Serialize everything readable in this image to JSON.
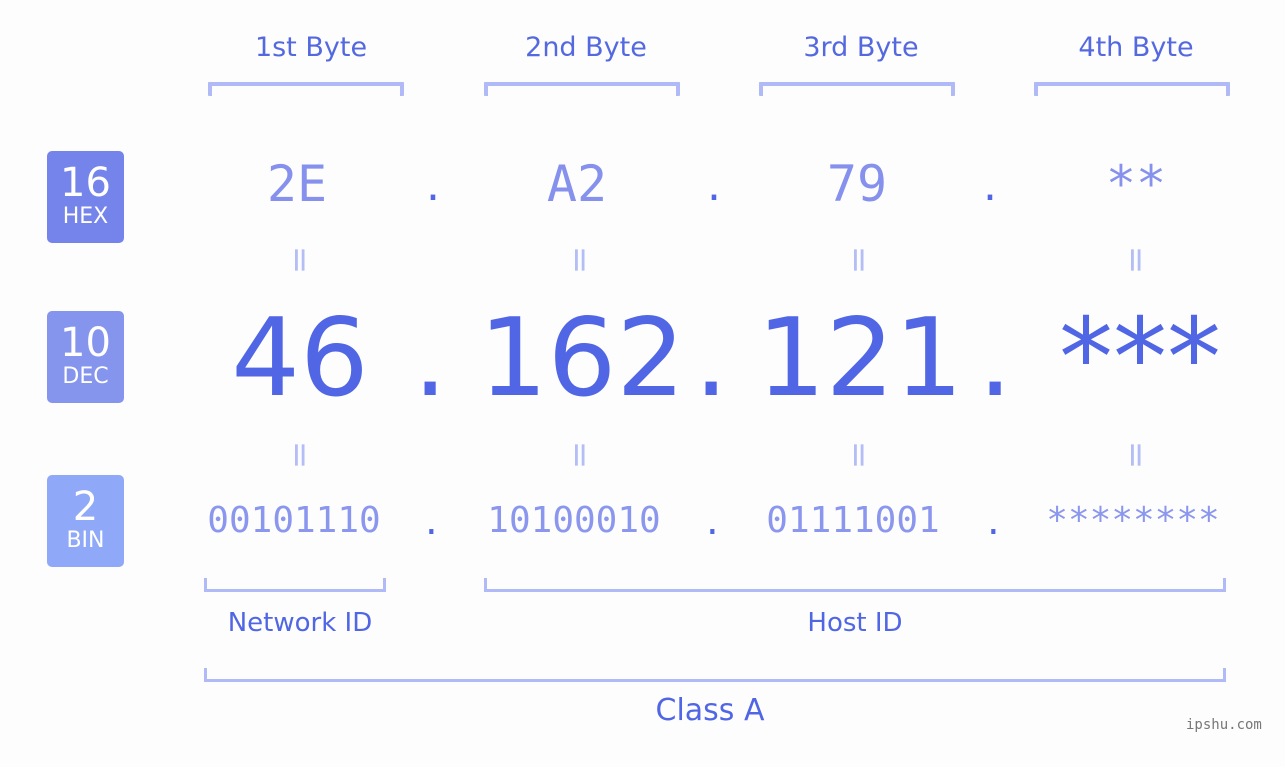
{
  "bytes": {
    "labels": [
      "1st Byte",
      "2nd Byte",
      "3rd Byte",
      "4th Byte"
    ]
  },
  "badges": {
    "hex": {
      "num": "16",
      "name": "HEX",
      "color": "#7584ea"
    },
    "dec": {
      "num": "10",
      "name": "DEC",
      "color": "#8595ee"
    },
    "bin": {
      "num": "2",
      "name": "BIN",
      "color": "#8fa8f8"
    }
  },
  "hex": [
    "2E",
    "A2",
    "79",
    "**"
  ],
  "dec": [
    "46",
    "162",
    "121",
    "***"
  ],
  "bin": [
    "00101110",
    "10100010",
    "01111001",
    "********"
  ],
  "separator": ".",
  "equals": "=",
  "parts": {
    "network": "Network ID",
    "host": "Host ID",
    "class": "Class A"
  },
  "watermark": "ipshu.com"
}
